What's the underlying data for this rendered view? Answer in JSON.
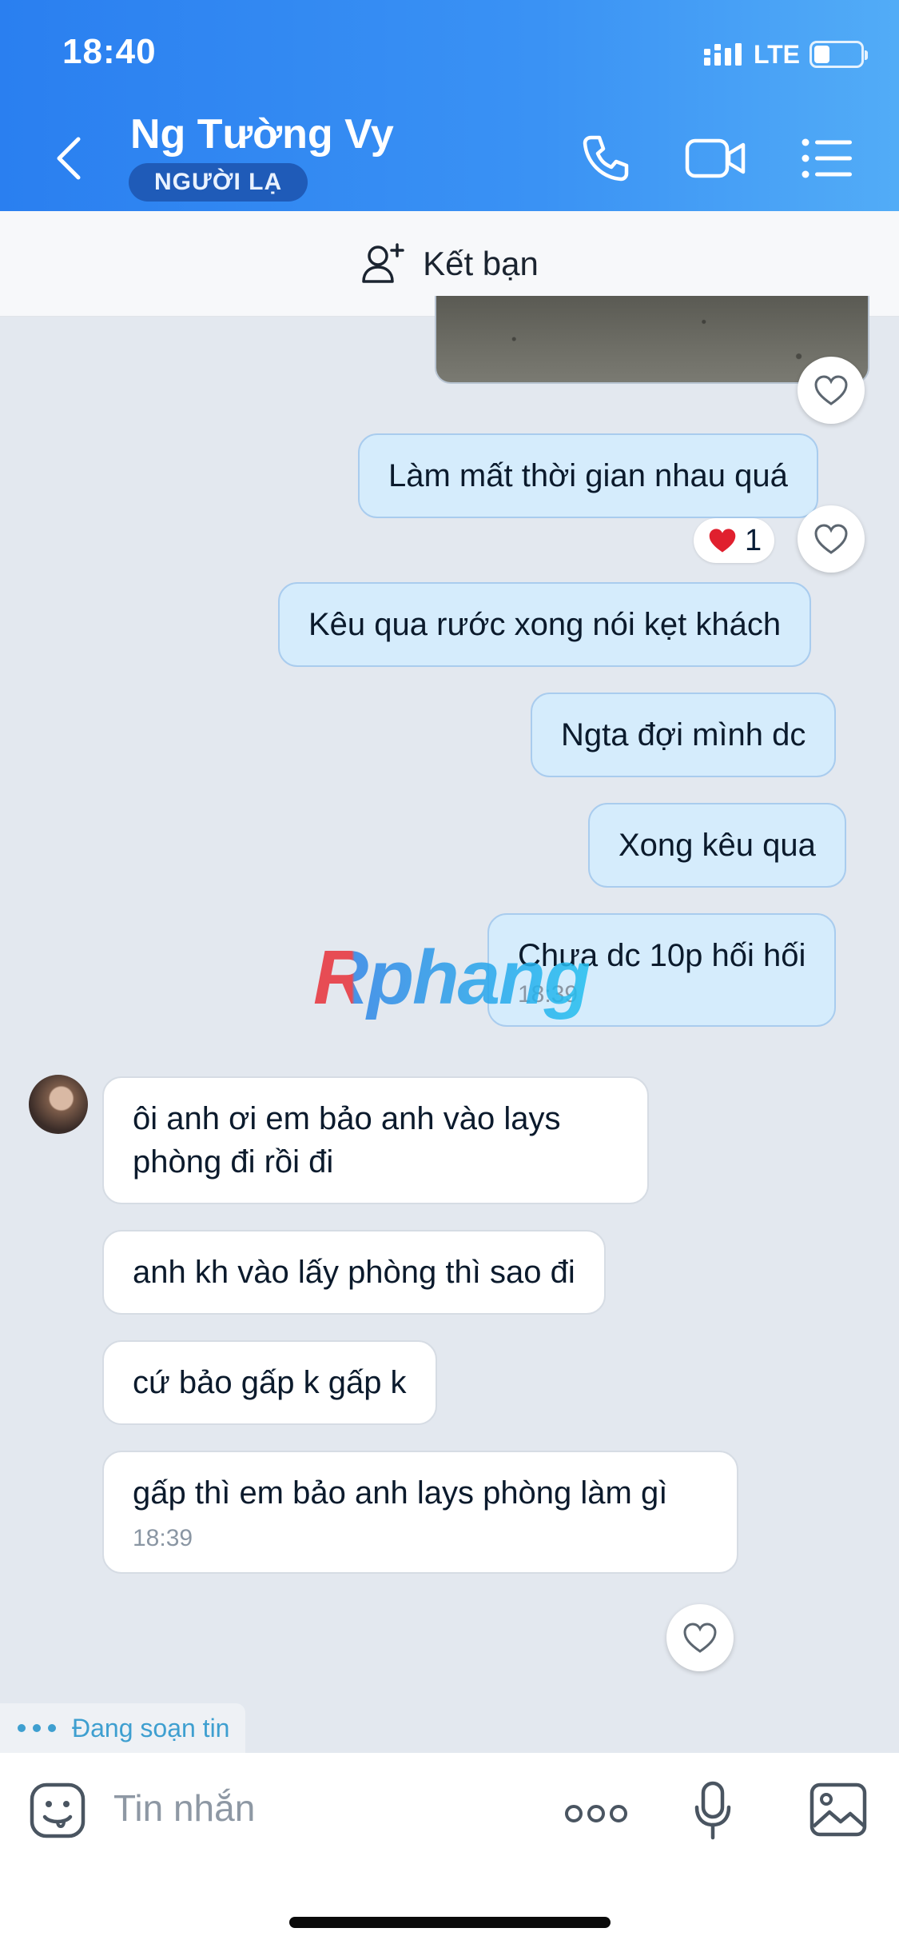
{
  "status_bar": {
    "time": "18:40",
    "network": "LTE"
  },
  "header": {
    "contact_name": "Ng Tường Vy",
    "badge": "NGƯỜI LẠ"
  },
  "friend_bar": {
    "label": "Kết bạn"
  },
  "messages": [
    {
      "direction": "out",
      "text": "Làm mất thời gian nhau quá",
      "reaction_count": "1"
    },
    {
      "direction": "out",
      "text": "Kêu qua rước xong nói kẹt khách"
    },
    {
      "direction": "out",
      "text": "Ngta đợi mình dc"
    },
    {
      "direction": "out",
      "text": "Xong kêu qua"
    },
    {
      "direction": "out",
      "text": "Chưa dc 10p hối hối",
      "time": "18:39"
    },
    {
      "direction": "in",
      "text": "ôi anh ơi em bảo anh vào lays phòng đi rồi đi"
    },
    {
      "direction": "in",
      "text": "anh kh vào lấy phòng thì sao đi"
    },
    {
      "direction": "in",
      "text": "cứ bảo gấp k gấp k"
    },
    {
      "direction": "in",
      "text": "gấp thì em bảo anh lays phòng làm gì",
      "time": "18:39"
    }
  ],
  "watermark": "Rphang",
  "typing_indicator": "Đang soạn tin",
  "input": {
    "placeholder": "Tin nhắn"
  },
  "colors": {
    "header_start": "#2a7ff0",
    "header_end": "#52acf7",
    "outgoing_bubble": "#d5ecfc",
    "incoming_bubble": "#ffffff",
    "chat_background": "#e3e8ef",
    "reaction_heart": "#e0202e"
  }
}
